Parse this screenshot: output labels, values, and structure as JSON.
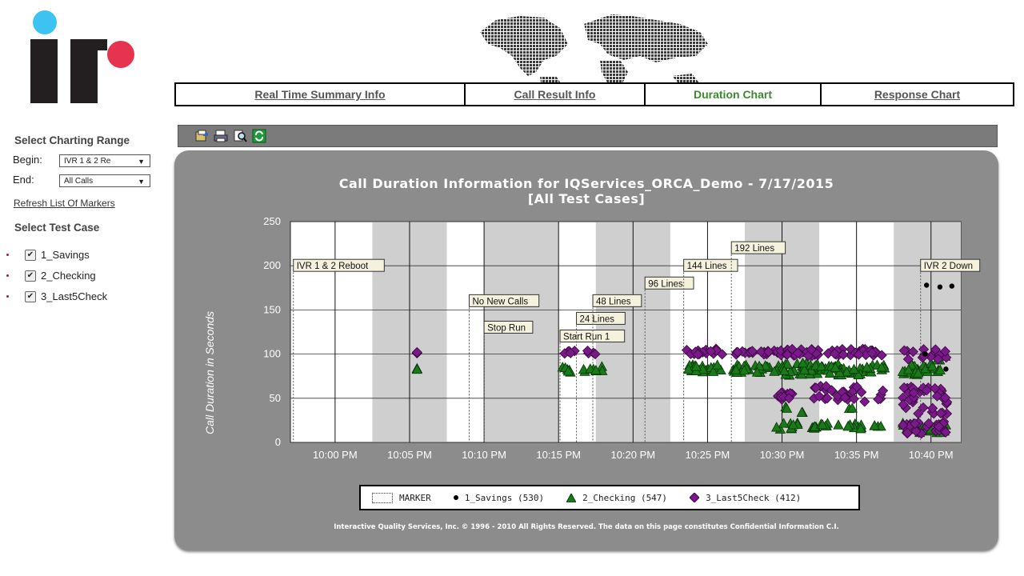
{
  "nav": {
    "tabs": [
      {
        "label": "Real Time Summary Info",
        "active": false
      },
      {
        "label": "Call Result Info",
        "active": false
      },
      {
        "label": "Duration Chart",
        "active": true
      },
      {
        "label": "Response Chart",
        "active": false
      }
    ]
  },
  "sidebar": {
    "range_title": "Select Charting Range",
    "begin_label": "Begin:",
    "begin_value": "IVR 1 & 2 Re",
    "end_label": "End:",
    "end_value": "All Calls",
    "refresh_link": "Refresh List Of Markers",
    "testcase_title": "Select Test Case",
    "test_cases": [
      {
        "label": "1_Savings",
        "checked": true
      },
      {
        "label": "2_Checking",
        "checked": true
      },
      {
        "label": "3_Last5Check",
        "checked": true
      }
    ]
  },
  "toolbar": {
    "icons": [
      "export-icon",
      "print-icon",
      "zoom-icon",
      "refresh-icon"
    ]
  },
  "colors": {
    "panel": "#8c8c8c",
    "active_tab": "#3c8a2e",
    "savings": "#000000",
    "checking": "#1a7a1a",
    "last5check": "#7a1a8a"
  },
  "chart_data": {
    "type": "scatter",
    "title": "Call Duration Information for IQServices_ORCA_Demo - 7/17/2015",
    "subtitle": "[All Test Cases]",
    "ylabel": "Call Duration in Seconds",
    "xlabel": "",
    "ylim": [
      0,
      250
    ],
    "yticks": [
      0,
      50,
      100,
      150,
      200,
      250
    ],
    "xlim": [
      -13,
      32
    ],
    "xticks": [
      {
        "v": -10,
        "label": "10:00 PM"
      },
      {
        "v": -5,
        "label": "10:05 PM"
      },
      {
        "v": 0,
        "label": "10:10 PM"
      },
      {
        "v": 5,
        "label": "10:15 PM"
      },
      {
        "v": 10,
        "label": "10:20 PM"
      },
      {
        "v": 15,
        "label": "10:25 PM"
      },
      {
        "v": 20,
        "label": "10:30 PM"
      },
      {
        "v": 25,
        "label": "10:35 PM"
      },
      {
        "v": 30,
        "label": "10:40 PM"
      }
    ],
    "shaded_bands": [
      [
        -7.5,
        -2.5
      ],
      [
        0,
        5
      ],
      [
        7.5,
        12.5
      ],
      [
        17.5,
        22.5
      ],
      [
        27.5,
        32
      ]
    ],
    "markers": [
      {
        "x": -12.8,
        "label": "IVR 1 & 2 Reboot",
        "y": 200
      },
      {
        "x": -1,
        "label": "No New Calls",
        "y": 160
      },
      {
        "x": 0,
        "label": "Stop Run",
        "y": 130
      },
      {
        "x": 5.1,
        "label": "Start Run 1",
        "y": 120
      },
      {
        "x": 6.2,
        "label": "24 Lines",
        "y": 140
      },
      {
        "x": 7.3,
        "label": "48 Lines",
        "y": 160
      },
      {
        "x": 10.8,
        "label": "96 Lines",
        "y": 180
      },
      {
        "x": 13.4,
        "label": "144 Lines",
        "y": 200
      },
      {
        "x": 16.6,
        "label": "192 Lines",
        "y": 220
      },
      {
        "x": 29.3,
        "label": "IVR 2 Down",
        "y": 200
      }
    ],
    "legend": [
      {
        "name": "MARKER",
        "symbol": "marker"
      },
      {
        "name": "1_Savings (530)",
        "symbol": "dot"
      },
      {
        "name": "2_Checking (547)",
        "symbol": "triangle"
      },
      {
        "name": "3_Last5Check (412)",
        "symbol": "diamond"
      }
    ],
    "series": [
      {
        "name": "1_Savings",
        "symbol": "dot",
        "points": [
          [
            29.7,
            178
          ],
          [
            30.6,
            176
          ],
          [
            31.4,
            177
          ],
          [
            29.6,
            100
          ],
          [
            31,
            83
          ]
        ]
      },
      {
        "name": "2_Checking",
        "symbol": "triangle",
        "clusters": [
          {
            "x": [
              -4.5,
              -4.5
            ],
            "y": [
              82,
              85
            ],
            "n": 2
          },
          {
            "x": [
              5.2,
              6.1
            ],
            "y": [
              79,
              86
            ],
            "n": 6
          },
          {
            "x": [
              6.5,
              8
            ],
            "y": [
              80,
              86
            ],
            "n": 8
          },
          {
            "x": [
              13.6,
              16
            ],
            "y": [
              79,
              88
            ],
            "n": 22
          },
          {
            "x": [
              16.7,
              20
            ],
            "y": [
              79,
              88
            ],
            "n": 26
          },
          {
            "x": [
              20,
              23
            ],
            "y": [
              76,
              90
            ],
            "n": 34
          },
          {
            "x": [
              23,
              25.5
            ],
            "y": [
              76,
              90
            ],
            "n": 28
          },
          {
            "x": [
              25.5,
              27
            ],
            "y": [
              78,
              88
            ],
            "n": 12
          },
          {
            "x": [
              28,
              30
            ],
            "y": [
              76,
              88
            ],
            "n": 22
          },
          {
            "x": [
              30,
              31
            ],
            "y": [
              80,
              100
            ],
            "n": 8
          },
          {
            "x": [
              19.6,
              21.3
            ],
            "y": [
              15,
              22
            ],
            "n": 10
          },
          {
            "x": [
              22,
              24
            ],
            "y": [
              15,
              22
            ],
            "n": 14
          },
          {
            "x": [
              24.3,
              25.6
            ],
            "y": [
              15,
              22
            ],
            "n": 10
          },
          {
            "x": [
              26.2,
              26.8
            ],
            "y": [
              17,
              21
            ],
            "n": 4
          },
          {
            "x": [
              28.1,
              31.1
            ],
            "y": [
              10,
              22
            ],
            "n": 22
          },
          {
            "x": [
              32,
              33
            ],
            "y": [
              10,
              38
            ],
            "n": 6
          },
          {
            "x": [
              20.2,
              20.4
            ],
            "y": [
              38,
              42
            ],
            "n": 2
          },
          {
            "x": [
              21.3,
              21.6
            ],
            "y": [
              32,
              36
            ],
            "n": 2
          },
          {
            "x": [
              24.5,
              24.8
            ],
            "y": [
              36,
              40
            ],
            "n": 2
          },
          {
            "x": [
              32.5,
              33
            ],
            "y": [
              82,
              86
            ],
            "n": 2
          }
        ]
      },
      {
        "name": "3_Last5Check",
        "symbol": "diamond",
        "clusters": [
          {
            "x": [
              -4.5,
              -4.5
            ],
            "y": [
              101,
              104
            ],
            "n": 2
          },
          {
            "x": [
              5.2,
              6.1
            ],
            "y": [
              100,
              104
            ],
            "n": 5
          },
          {
            "x": [
              6.7,
              7.5
            ],
            "y": [
              100,
              104
            ],
            "n": 4
          },
          {
            "x": [
              13.5,
              16
            ],
            "y": [
              99,
              106
            ],
            "n": 18
          },
          {
            "x": [
              16.7,
              20
            ],
            "y": [
              99,
              104
            ],
            "n": 22
          },
          {
            "x": [
              20,
              23
            ],
            "y": [
              98,
              106
            ],
            "n": 24
          },
          {
            "x": [
              23,
              26.8
            ],
            "y": [
              98,
              106
            ],
            "n": 26
          },
          {
            "x": [
              28.1,
              31.1
            ],
            "y": [
              94,
              106
            ],
            "n": 16
          },
          {
            "x": [
              19.6,
              21
            ],
            "y": [
              48,
              62
            ],
            "n": 10
          },
          {
            "x": [
              22.1,
              23.9
            ],
            "y": [
              46,
              64
            ],
            "n": 14
          },
          {
            "x": [
              24,
              25.6
            ],
            "y": [
              46,
              64
            ],
            "n": 12
          },
          {
            "x": [
              26.2,
              26.8
            ],
            "y": [
              48,
              60
            ],
            "n": 4
          },
          {
            "x": [
              28.1,
              31.1
            ],
            "y": [
              32,
              64
            ],
            "n": 36
          },
          {
            "x": [
              28.1,
              31.1
            ],
            "y": [
              10,
              24
            ],
            "n": 26
          },
          {
            "x": [
              32,
              33
            ],
            "y": [
              10,
              38
            ],
            "n": 6
          },
          {
            "x": [
              31.7,
              32.2
            ],
            "y": [
              176,
              179
            ],
            "n": 2
          },
          {
            "x": [
              32.8,
              33.1
            ],
            "y": [
              100,
              104
            ],
            "n": 1
          },
          {
            "x": [
              28.7,
              28.9
            ],
            "y": [
              100,
              104
            ],
            "n": 1
          }
        ]
      }
    ]
  },
  "footer_text": "Interactive Quality Services, Inc. © 1996 - 2010 All Rights Reserved. The data on this page constitutes Confidential Information C.I."
}
